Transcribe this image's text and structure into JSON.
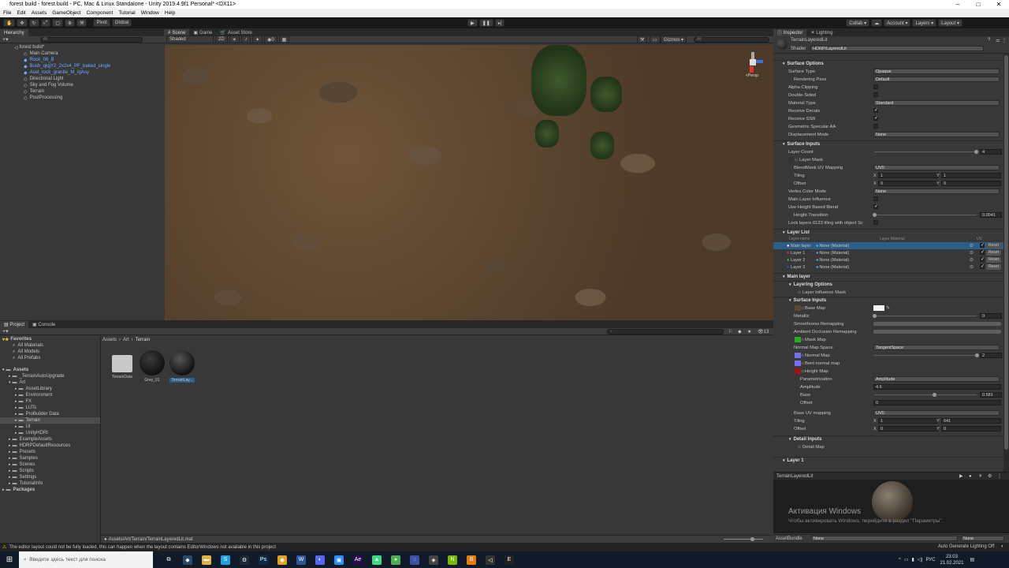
{
  "window": {
    "title": "forest build - forest build - PC, Mac & Linux Standalone - Unity 2019.4.9f1 Personal* <DX11>",
    "minimize": "–",
    "maximize": "□",
    "close": "✕"
  },
  "menu": [
    "File",
    "Edit",
    "Assets",
    "GameObject",
    "Component",
    "Tutorial",
    "Window",
    "Help"
  ],
  "toolbar": {
    "pivot": "Pivot",
    "global": "Global",
    "collab": "Collab ▾",
    "account": "Account ▾",
    "layers": "Layers ▾",
    "layout": "Layout ▾",
    "play_icon": "play-icon",
    "pause_icon": "pause-icon",
    "step_icon": "step-icon"
  },
  "hierarchy": {
    "tab": "Hierarchy",
    "search": "All",
    "scene": "forest build*",
    "items": [
      {
        "label": "Main Camera",
        "blue": false
      },
      {
        "label": "Rock_06_B",
        "blue": true
      },
      {
        "label": "Bush_qlqjY2_2x2x4_PF_baked_single",
        "blue": true
      },
      {
        "label": "Aset_rock_granite_M_rgAsy",
        "blue": true
      },
      {
        "label": "Directional Light",
        "blue": false
      },
      {
        "label": "Sky and Fog Volume",
        "blue": false
      },
      {
        "label": "Terrain",
        "blue": false
      },
      {
        "label": "PostProcessing",
        "blue": false
      }
    ]
  },
  "scene": {
    "tabs": [
      "Scene",
      "Game",
      "Asset Store"
    ],
    "shading": "Shaded",
    "mode2d": "2D",
    "gizmos": "Gizmos ▾",
    "search": "All",
    "persp": "<Persp"
  },
  "project": {
    "tabs": [
      "Project",
      "Console"
    ],
    "breadcrumb": [
      "Assets",
      "Art",
      "Terrain"
    ],
    "favorites_label": "Favorites",
    "favorites": [
      "All Materials",
      "All Models",
      "All Prefabs"
    ],
    "tree": [
      {
        "label": "Assets",
        "depth": 0,
        "bold": true
      },
      {
        "label": "_TerrainAutoUpgrade",
        "depth": 1
      },
      {
        "label": "Art",
        "depth": 1
      },
      {
        "label": "AssetLibrary",
        "depth": 2
      },
      {
        "label": "Environment",
        "depth": 2
      },
      {
        "label": "FX",
        "depth": 2
      },
      {
        "label": "LUTs",
        "depth": 2
      },
      {
        "label": "ProBuilder Data",
        "depth": 2
      },
      {
        "label": "Terrain",
        "depth": 2,
        "sel": true
      },
      {
        "label": "UI",
        "depth": 2
      },
      {
        "label": "UnityHDRI",
        "depth": 2
      },
      {
        "label": "ExampleAssets",
        "depth": 1
      },
      {
        "label": "HDRPDefaultResources",
        "depth": 1
      },
      {
        "label": "Presets",
        "depth": 1
      },
      {
        "label": "Samples",
        "depth": 1
      },
      {
        "label": "Scenes",
        "depth": 1
      },
      {
        "label": "Scripts",
        "depth": 1
      },
      {
        "label": "Settings",
        "depth": 1
      },
      {
        "label": "TutorialInfo",
        "depth": 1
      },
      {
        "label": "Packages",
        "depth": 0,
        "bold": true
      }
    ],
    "files": [
      {
        "label": "TerrainData",
        "kind": "folder"
      },
      {
        "label": "Grey_01",
        "kind": "sphere"
      },
      {
        "label": "TerrainLay...",
        "kind": "sphere"
      }
    ],
    "count": "13",
    "path": "Assets/Art/Terrain/TerrainLayeredLit.mat"
  },
  "inspector": {
    "tabs": [
      "Inspector",
      "Lighting"
    ],
    "name": "TerrainLayeredLit",
    "shader_label": "Shader",
    "shader": "HDRP/LayeredLit",
    "surface_options": "Surface Options",
    "so": [
      {
        "n": "Surface Type",
        "v": "Opaque",
        "t": "dd"
      },
      {
        "n": "Rendering Pass",
        "v": "Default",
        "t": "dd",
        "i": 1
      },
      {
        "n": "Alpha Clipping",
        "t": "cb",
        "c": ""
      },
      {
        "n": "Double-Sided",
        "t": "cb",
        "c": ""
      },
      {
        "n": "Material Type",
        "v": "Standard",
        "t": "dd"
      },
      {
        "n": "Receive Decals",
        "t": "cb",
        "c": "✓"
      },
      {
        "n": "Receive SSR",
        "t": "cb",
        "c": "✓"
      },
      {
        "n": "Geometric Specular AA",
        "t": "cb",
        "c": ""
      },
      {
        "n": "Displacement Mode",
        "v": "None",
        "t": "dd"
      }
    ],
    "surface_inputs": "Surface Inputs",
    "layer_count_label": "Layer Count",
    "layer_count": "4",
    "layer_mask": "Layer Mask",
    "blendmask_uv": "BlendMask UV Mapping",
    "uv0": "UV0",
    "tiling": "Tiling",
    "offset": "Offset",
    "x": "X",
    "y": "Y",
    "one": "1",
    "zero": "0",
    "vertex_color_mode": "Vertex Color Mode",
    "none": "None",
    "main_layer_influence": "Main Layer Influence",
    "use_height_blend": "Use Height Based Blend",
    "height_transition": "Height Transition",
    "height_transition_val": "0.0041",
    "lock_layers": "Lock layers 0123 tiling with object Sc",
    "layer_list": "Layer List",
    "layer_name_hdr": "Layer name",
    "layer_material_hdr": "Layer Material",
    "uv_hdr": "UV",
    "reset": "Reset",
    "layers": [
      {
        "name": "Main layer",
        "mat": "None (Material)",
        "color": "#ffffff"
      },
      {
        "name": "Layer 1",
        "mat": "None (Material)",
        "color": "#e03030"
      },
      {
        "name": "Layer 2",
        "mat": "None (Material)",
        "color": "#30c030"
      },
      {
        "name": "Layer 3",
        "mat": "None (Material)",
        "color": "#3050e0"
      }
    ],
    "main_layer": "Main layer",
    "layering_options": "Layering Options",
    "layer_influence_mask": "Layer Influence Mask",
    "surface_inputs2": "Surface Inputs",
    "base_map": "Base Map",
    "metallic": "Metallic",
    "metallic_val": "0",
    "smoothness": "Smoothness Remapping",
    "ao": "Ambient Occlusion Remapping",
    "mask_map": "Mask Map",
    "normal_map_space": "Normal Map Space",
    "tangent_space": "TangentSpace",
    "normal_map": "Normal Map",
    "normal_val": "2",
    "bent_normal": "Bent normal map",
    "height_map": "Height Map",
    "parametrization": "Parametrization",
    "amplitude_label": "Amplitude",
    "amplitude_val": "4.6",
    "base_label": "Base",
    "base_val": "0.581",
    "offset_label": "Offset",
    "offset_val": "0",
    "base_uv": "Base UV mapping",
    "tiling_y": "641",
    "detail_inputs": "Detail Inputs",
    "detail_map": "Detail Map",
    "layer_cut": "Layer 1",
    "preview_title": "TerrainLayeredLit",
    "assetbundle": "AssetBundle",
    "none2": "None"
  },
  "activation": {
    "title": "Активация Windows",
    "sub": "Чтобы активировать Windows, перейдите в раздел \"Параметры\"."
  },
  "status": {
    "message": "The editor layout could not be fully loaded, this can happen when the layout contains EditorWindows not available in this project",
    "right": "Auto Generate Lighting Off"
  },
  "taskbar": {
    "search": "Введите здесь текст для поиска",
    "lang": "РУС",
    "time": "23:03",
    "date": "21.02.2021",
    "apps": [
      {
        "icon": "task-view-icon",
        "c": "#101a29",
        "g": "⧉"
      },
      {
        "icon": "app-icon",
        "c": "#2a4a6a",
        "g": "◆"
      },
      {
        "icon": "folder-icon",
        "c": "#e0b040",
        "g": "▬"
      },
      {
        "icon": "skype-icon",
        "c": "#1fa2e0",
        "g": "S"
      },
      {
        "icon": "steam-icon",
        "c": "#1b2838",
        "g": "⚙"
      },
      {
        "icon": "photoshop-icon",
        "c": "#0d2a45",
        "g": "Ps"
      },
      {
        "icon": "chrome-icon",
        "c": "#e0a020",
        "g": "◉"
      },
      {
        "icon": "word-icon",
        "c": "#2b579a",
        "g": "W"
      },
      {
        "icon": "discord-icon",
        "c": "#5865f2",
        "g": "◐"
      },
      {
        "icon": "zoom-icon",
        "c": "#2d8cff",
        "g": "▣"
      },
      {
        "icon": "aftereffects-icon",
        "c": "#2a0a4a",
        "g": "Ae"
      },
      {
        "icon": "android-icon",
        "c": "#3ddc84",
        "g": "▲"
      },
      {
        "icon": "green-app-icon",
        "c": "#4caf50",
        "g": "●"
      },
      {
        "icon": "blue-app-icon",
        "c": "#4050a0",
        "g": "◌"
      },
      {
        "icon": "gamepad-icon",
        "c": "#444",
        "g": "◈"
      },
      {
        "icon": "nvidia-icon",
        "c": "#76b900",
        "g": "N"
      },
      {
        "icon": "blender-icon",
        "c": "#e87d0d",
        "g": "B"
      },
      {
        "icon": "unity-icon",
        "c": "#333",
        "g": "◁"
      },
      {
        "icon": "epic-icon",
        "c": "#222",
        "g": "E"
      }
    ]
  }
}
